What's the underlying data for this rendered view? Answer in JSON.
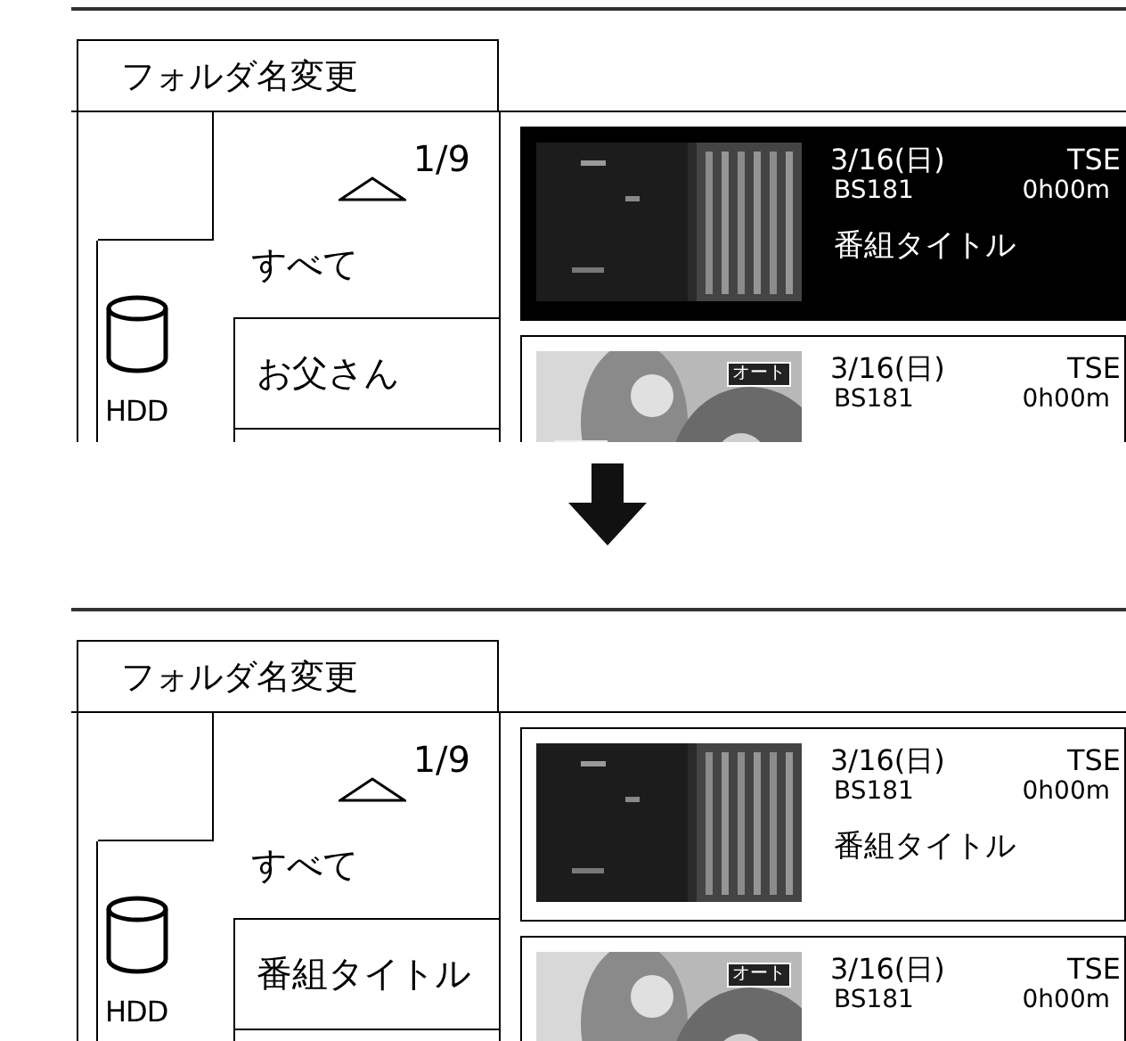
{
  "screens": [
    {
      "title": "フォルダ名変更",
      "page": "1/9",
      "drive": "HDD",
      "folders": [
        {
          "label": "すべて"
        },
        {
          "label": "お父さん"
        }
      ],
      "recordings": [
        {
          "kind": "picture",
          "date": "3/16(日)",
          "channel_code": "TSE",
          "channel": "BS181",
          "duration": "0h00m",
          "title": "番組タイトル",
          "selected": true
        },
        {
          "kind": "picture",
          "date": "3/16(日)",
          "channel_code": "TSE",
          "channel": "BS181",
          "duration": "0h00m",
          "badge": "オート",
          "selected": false
        }
      ]
    },
    {
      "title": "フォルダ名変更",
      "page": "1/9",
      "drive": "HDD",
      "folders": [
        {
          "label": "すべて"
        },
        {
          "label": "番組タイトル"
        }
      ],
      "recordings": [
        {
          "kind": "picture",
          "date": "3/16(日)",
          "channel_code": "TSE",
          "channel": "BS181",
          "duration": "0h00m",
          "title": "番組タイトル",
          "selected": false
        },
        {
          "kind": "picture",
          "date": "3/16(日)",
          "channel_code": "TSE",
          "channel": "BS181",
          "duration": "0h00m",
          "badge": "オート",
          "selected": false
        }
      ]
    }
  ]
}
